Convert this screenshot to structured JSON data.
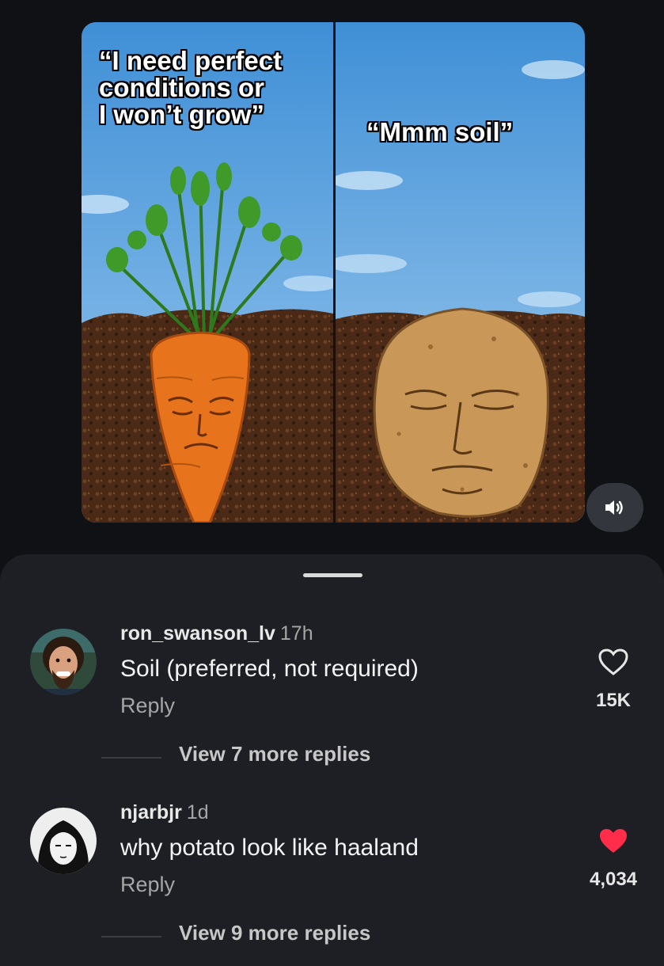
{
  "meme": {
    "left_caption": "“I need perfect\nconditions or\nI won’t grow”",
    "right_caption": "“Mmm soil”"
  },
  "sound_icon": "speaker-icon",
  "comments": [
    {
      "username": "ron_swanson_lv",
      "time": "17h",
      "text": "Soil (preferred, not required)",
      "reply_label": "Reply",
      "like_count": "15K",
      "liked": false,
      "view_more": "View 7 more replies"
    },
    {
      "username": "njarbjr",
      "time": "1d",
      "text": "why potato look like haaland",
      "reply_label": "Reply",
      "like_count": "4,034",
      "liked": true,
      "view_more": "View 9 more replies"
    }
  ],
  "colors": {
    "background": "#0f1115",
    "sheet": "#1e1f24",
    "like_red": "#ff2d4a"
  }
}
